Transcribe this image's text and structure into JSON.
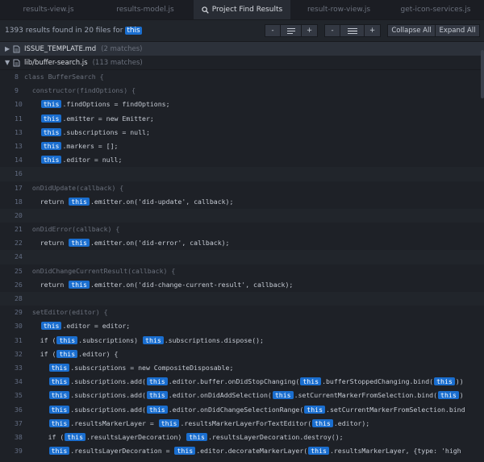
{
  "tabs": [
    {
      "label": "results-view.js",
      "active": false
    },
    {
      "label": "results-model.js",
      "active": false
    },
    {
      "label": "Project Find Results",
      "active": true,
      "icon": "search-icon"
    },
    {
      "label": "result-row-view.js",
      "active": false
    },
    {
      "label": "get-icon-services.js",
      "active": false
    }
  ],
  "summary": {
    "prefix": "1393 results found in 20 files for",
    "term": "this"
  },
  "toolbar": {
    "decrease_label": "-",
    "increase_label": "+",
    "decrease2_label": "-",
    "increase2_label": "+",
    "collapse_all": "Collapse All",
    "expand_all": "Expand All"
  },
  "files": [
    {
      "name": "ISSUE_TEMPLATE.md",
      "count": "(2 matches)"
    },
    {
      "name": "lib/buffer-search.js",
      "count": "(113 matches)"
    }
  ],
  "lines": [
    {
      "n": "8",
      "pre": "class BufferSearch {",
      "parts": []
    },
    {
      "n": "9",
      "pre": "  constructor(findOptions) {",
      "parts": []
    },
    {
      "n": "10",
      "pre": "    ",
      "parts": [
        {
          "h": "this"
        },
        {
          "t": ".findOptions = findOptions;"
        }
      ]
    },
    {
      "n": "11",
      "pre": "    ",
      "parts": [
        {
          "h": "this"
        },
        {
          "t": ".emitter = new Emitter;"
        }
      ]
    },
    {
      "n": "13",
      "pre": "    ",
      "parts": [
        {
          "h": "this"
        },
        {
          "t": ".subscriptions = null;"
        }
      ]
    },
    {
      "n": "13",
      "pre": "    ",
      "parts": [
        {
          "h": "this"
        },
        {
          "t": ".markers = [];"
        }
      ]
    },
    {
      "n": "14",
      "pre": "    ",
      "parts": [
        {
          "h": "this"
        },
        {
          "t": ".editor = null;"
        }
      ]
    },
    {
      "n": "16",
      "pre": "",
      "parts": []
    },
    {
      "n": "17",
      "pre": "  onDidUpdate(callback) {",
      "parts": []
    },
    {
      "n": "18",
      "pre": "    return ",
      "parts": [
        {
          "h": "this"
        },
        {
          "t": ".emitter.on('did-update', callback);"
        }
      ]
    },
    {
      "n": "20",
      "pre": "",
      "parts": []
    },
    {
      "n": "21",
      "pre": "  onDidError(callback) {",
      "parts": []
    },
    {
      "n": "22",
      "pre": "    return ",
      "parts": [
        {
          "h": "this"
        },
        {
          "t": ".emitter.on('did-error', callback);"
        }
      ]
    },
    {
      "n": "24",
      "pre": "",
      "parts": []
    },
    {
      "n": "25",
      "pre": "  onDidChangeCurrentResult(callback) {",
      "parts": []
    },
    {
      "n": "26",
      "pre": "    return ",
      "parts": [
        {
          "h": "this"
        },
        {
          "t": ".emitter.on('did-change-current-result', callback);"
        }
      ]
    },
    {
      "n": "28",
      "pre": "",
      "parts": []
    },
    {
      "n": "29",
      "pre": "  setEditor(editor) {",
      "parts": []
    },
    {
      "n": "30",
      "pre": "    ",
      "parts": [
        {
          "h": "this"
        },
        {
          "t": ".editor = editor;"
        }
      ]
    },
    {
      "n": "31",
      "pre": "    if (",
      "parts": [
        {
          "h": "this"
        },
        {
          "t": ".subscriptions) "
        },
        {
          "h": "this"
        },
        {
          "t": ".subscriptions.dispose();"
        }
      ]
    },
    {
      "n": "32",
      "pre": "    if (",
      "parts": [
        {
          "h": "this"
        },
        {
          "t": ".editor) {"
        }
      ]
    },
    {
      "n": "33",
      "pre": "      ",
      "parts": [
        {
          "h": "this"
        },
        {
          "t": ".subscriptions = new CompositeDisposable;"
        }
      ]
    },
    {
      "n": "34",
      "pre": "      ",
      "parts": [
        {
          "h": "this"
        },
        {
          "t": ".subscriptions.add("
        },
        {
          "h": "this"
        },
        {
          "t": ".editor.buffer.onDidStopChanging("
        },
        {
          "h": "this"
        },
        {
          "t": ".bufferStoppedChanging.bind("
        },
        {
          "h": "this"
        },
        {
          "t": "))"
        }
      ]
    },
    {
      "n": "35",
      "pre": "      ",
      "parts": [
        {
          "h": "this"
        },
        {
          "t": ".subscriptions.add("
        },
        {
          "h": "this"
        },
        {
          "t": ".editor.onDidAddSelection("
        },
        {
          "h": "this"
        },
        {
          "t": ".setCurrentMarkerFromSelection.bind("
        },
        {
          "h": "this"
        },
        {
          "t": ")"
        }
      ]
    },
    {
      "n": "36",
      "pre": "      ",
      "parts": [
        {
          "h": "this"
        },
        {
          "t": ".subscriptions.add("
        },
        {
          "h": "this"
        },
        {
          "t": ".editor.onDidChangeSelectionRange("
        },
        {
          "h": "this"
        },
        {
          "t": ".setCurrentMarkerFromSelection.bind"
        }
      ]
    },
    {
      "n": "37",
      "pre": "      ",
      "parts": [
        {
          "h": "this"
        },
        {
          "t": ".resultsMarkerLayer = "
        },
        {
          "h": "this"
        },
        {
          "t": ".resultsMarkerLayerForTextEditor("
        },
        {
          "h": "this"
        },
        {
          "t": ".editor);"
        }
      ]
    },
    {
      "n": "38",
      "pre": "      if (",
      "parts": [
        {
          "h": "this"
        },
        {
          "t": ".resultsLayerDecoration) "
        },
        {
          "h": "this"
        },
        {
          "t": ".resultsLayerDecoration.destroy();"
        }
      ]
    },
    {
      "n": "39",
      "pre": "      ",
      "parts": [
        {
          "h": "this"
        },
        {
          "t": ".resultsLayerDecoration = "
        },
        {
          "h": "this"
        },
        {
          "t": ".editor.decorateMarkerLayer("
        },
        {
          "h": "this"
        },
        {
          "t": ".resultsMarkerLayer, {type: 'high"
        }
      ]
    }
  ],
  "context_lines": [
    0,
    1,
    8,
    11,
    14,
    17
  ],
  "alt_rows": [
    7,
    10,
    13,
    16
  ],
  "colors": {
    "highlight": "#1a6ecf",
    "background": "#1e2127",
    "active_tab": "#282c34"
  }
}
